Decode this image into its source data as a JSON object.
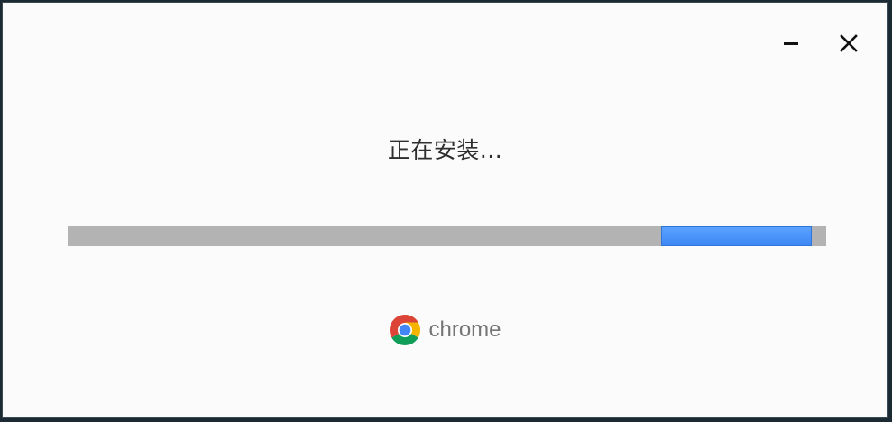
{
  "window": {
    "minimize_icon": "minimize-icon",
    "close_icon": "close-icon"
  },
  "installer": {
    "status": "正在安装...",
    "progress_indeterminate": true,
    "progress_chunk_start": 0.782,
    "progress_chunk_fraction": 0.198
  },
  "brand": {
    "logo_icon": "chrome-logo-icon",
    "name": "chrome"
  },
  "colors": {
    "background": "#fbfbfc",
    "progress_track": "#b3b3b3",
    "progress_fill": "#3a86f5",
    "brand_text": "#757575",
    "chrome_red": "#db4437",
    "chrome_yellow": "#f4b400",
    "chrome_green": "#0f9d58",
    "chrome_blue": "#4285f4"
  }
}
